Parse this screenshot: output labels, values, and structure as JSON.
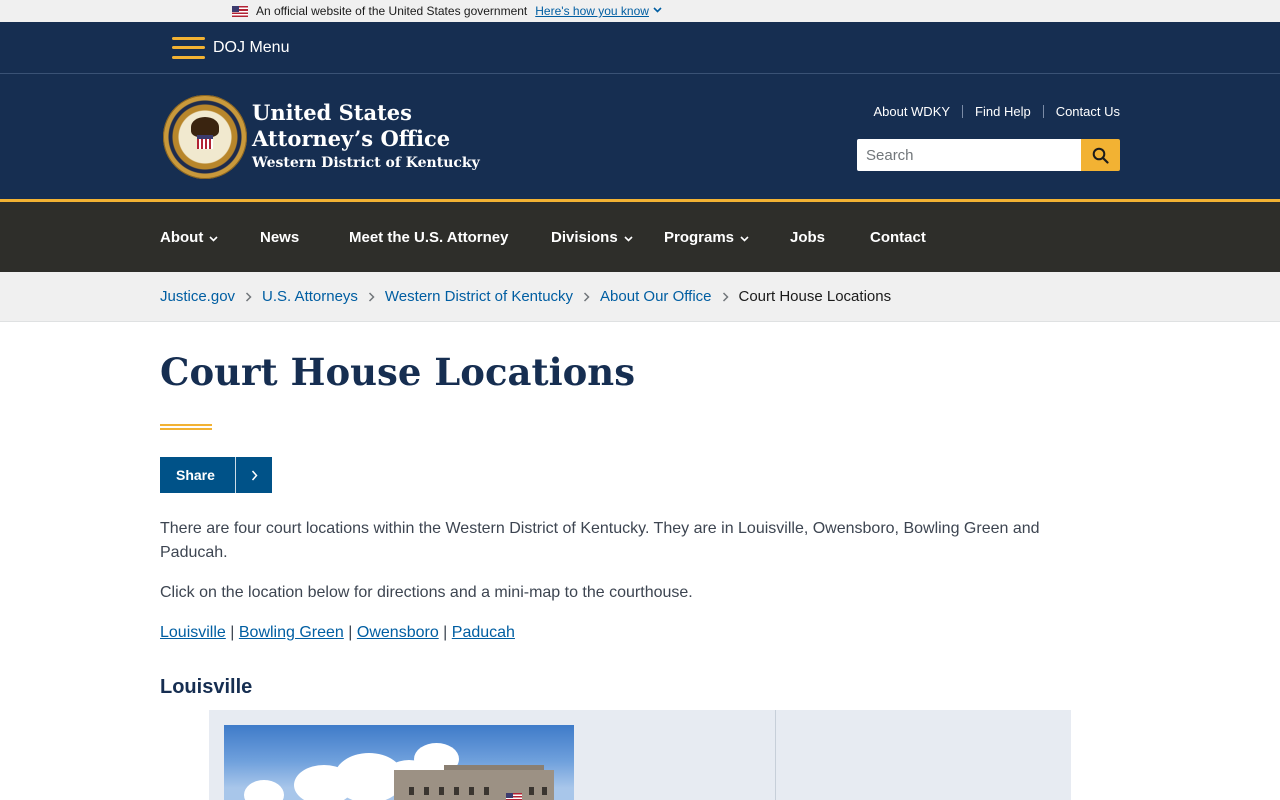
{
  "gov_banner": {
    "text": "An official website of the United States government",
    "link": "Here's how you know"
  },
  "doj_menu": {
    "label": "DOJ Menu"
  },
  "header": {
    "title_line1": "United States",
    "title_line2": "Attorney’s Office",
    "subtitle": "Western District of Kentucky",
    "utility_links": [
      "About WDKY",
      "Find Help",
      "Contact Us"
    ],
    "search_placeholder": "Search"
  },
  "nav": {
    "items": [
      {
        "label": "About",
        "dropdown": true
      },
      {
        "label": "News",
        "dropdown": false
      },
      {
        "label": "Meet the U.S. Attorney",
        "dropdown": false
      },
      {
        "label": "Divisions",
        "dropdown": true
      },
      {
        "label": "Programs",
        "dropdown": true
      },
      {
        "label": "Jobs",
        "dropdown": false
      },
      {
        "label": "Contact",
        "dropdown": false
      }
    ]
  },
  "breadcrumb": {
    "links": [
      "Justice.gov",
      "U.S. Attorneys",
      "Western District of Kentucky",
      "About Our Office"
    ],
    "current": "Court House Locations"
  },
  "page": {
    "title": "Court House Locations",
    "share_label": "Share",
    "paragraph1": "There are four court locations within the Western District of Kentucky. They are in Louisville, Owensboro, Bowling Green and Paducah.",
    "paragraph2": "Click on the location below for directions and a mini-map to the courthouse.",
    "location_links": [
      "Louisville",
      "Bowling Green",
      "Owensboro",
      "Paducah"
    ],
    "location_separator": "|",
    "section_heading": "Louisville"
  },
  "colors": {
    "navy": "#162e51",
    "gold": "#f2b233",
    "nav_dark": "#2e2e2a",
    "link_blue": "#005ea2",
    "share_blue": "#005288"
  },
  "icons": {
    "menu": "hamburger-icon",
    "search": "search-icon",
    "share_arrow": "chevron-right-icon",
    "nav_caret": "chevron-down-icon"
  }
}
